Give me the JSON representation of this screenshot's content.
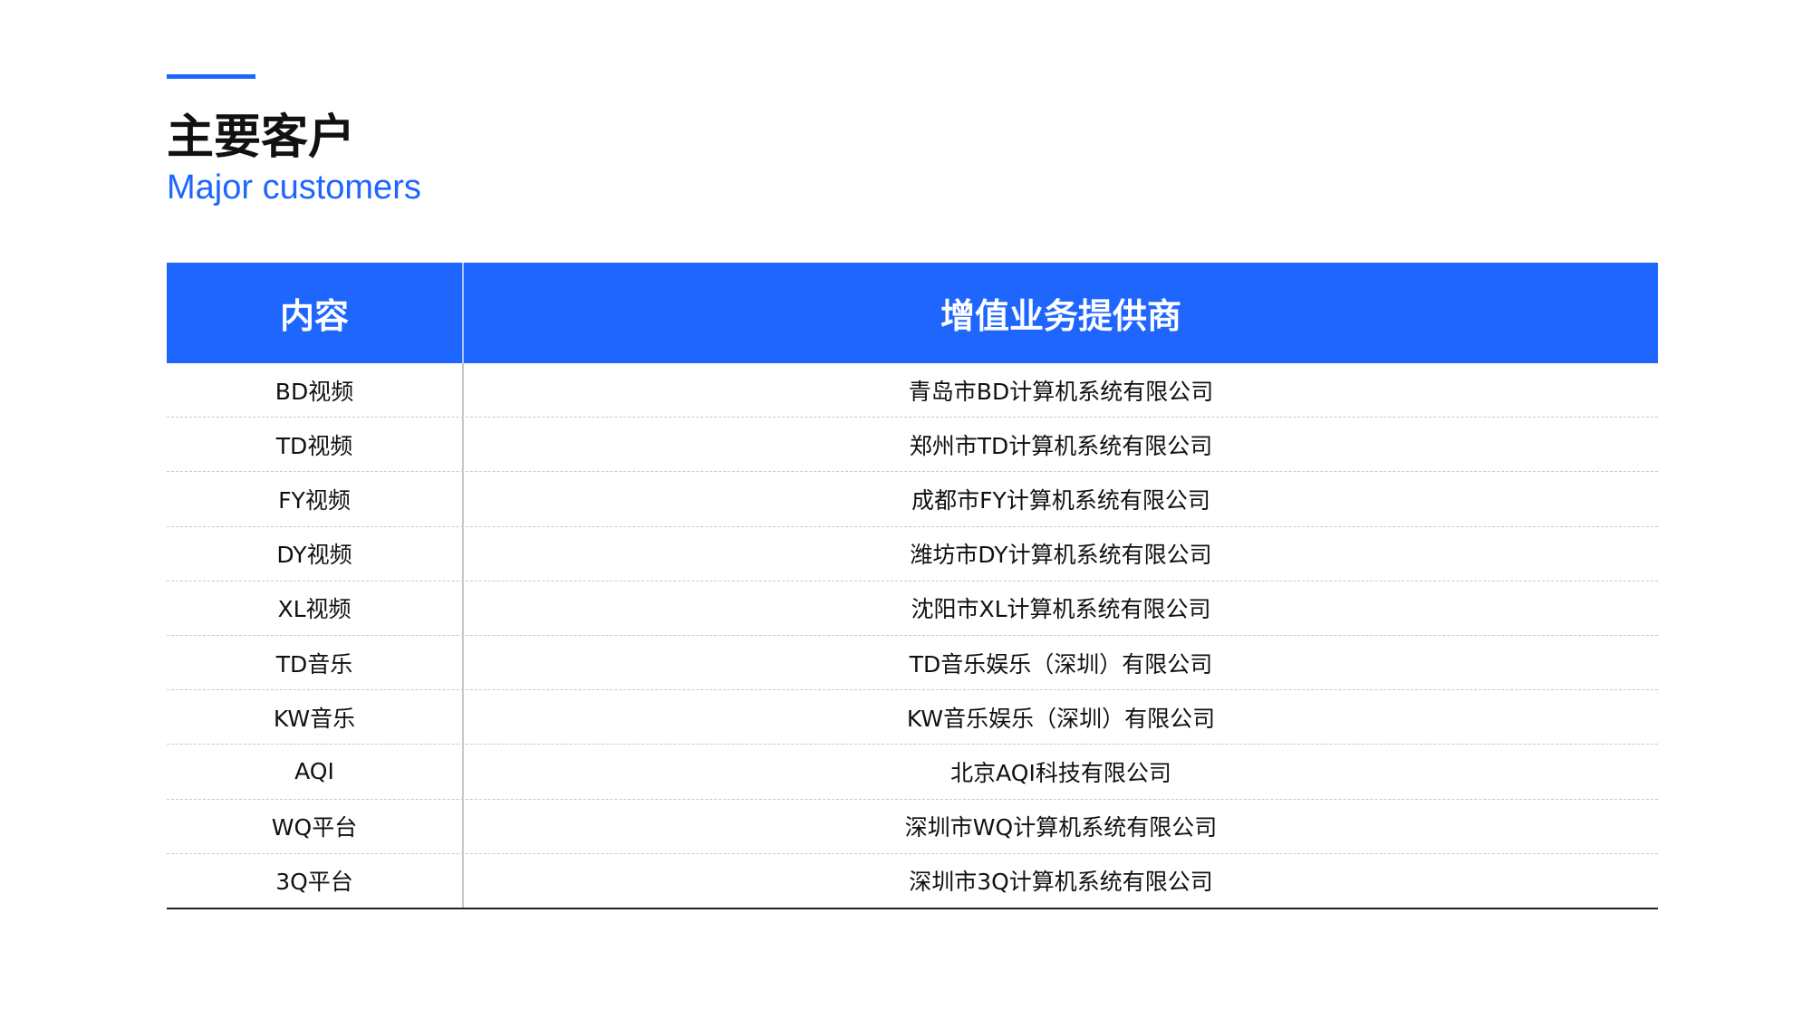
{
  "header": {
    "title_cn": "主要客户",
    "title_en": "Major customers"
  },
  "colors": {
    "accent": "#1f66ff",
    "header_text": "#ffffff",
    "body_text": "#111111"
  },
  "table": {
    "columns": [
      "内容",
      "增值业务提供商"
    ],
    "rows": [
      {
        "content": "BD视频",
        "provider": "青岛市BD计算机系统有限公司"
      },
      {
        "content": "TD视频",
        "provider": "郑州市TD计算机系统有限公司"
      },
      {
        "content": "FY视频",
        "provider": "成都市FY计算机系统有限公司"
      },
      {
        "content": "DY视频",
        "provider": "潍坊市DY计算机系统有限公司"
      },
      {
        "content": "XL视频",
        "provider": "沈阳市XL计算机系统有限公司"
      },
      {
        "content": "TD音乐",
        "provider": "TD音乐娱乐（深圳）有限公司"
      },
      {
        "content": "KW音乐",
        "provider": "KW音乐娱乐（深圳）有限公司"
      },
      {
        "content": "AQI",
        "provider": "北京AQI科技有限公司"
      },
      {
        "content": "WQ平台",
        "provider": "深圳市WQ计算机系统有限公司"
      },
      {
        "content": "3Q平台",
        "provider": "深圳市3Q计算机系统有限公司"
      }
    ]
  }
}
